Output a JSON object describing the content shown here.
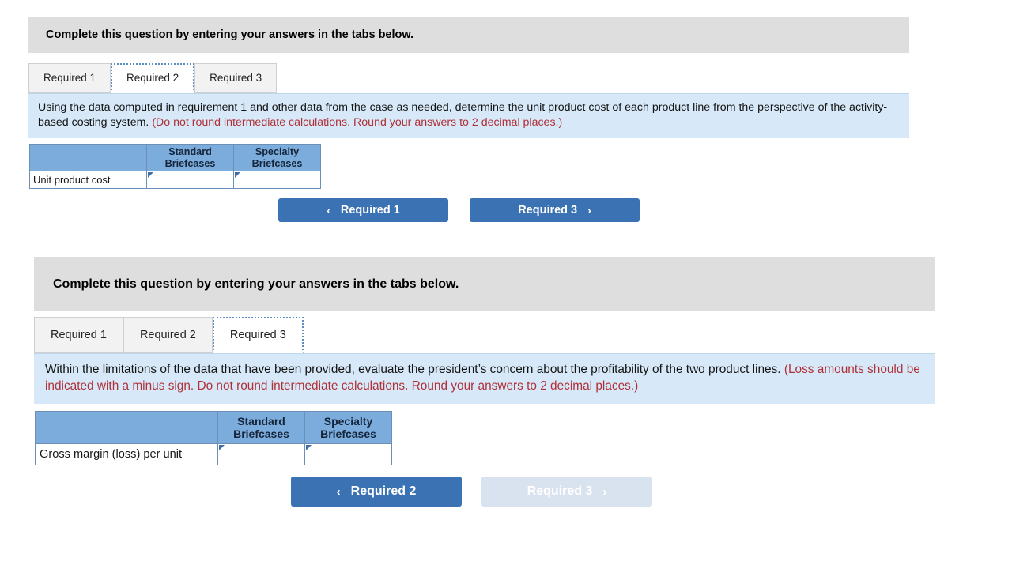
{
  "panels": [
    {
      "banner": "Complete this question by entering your answers in the tabs below.",
      "tabs": [
        {
          "label": "Required 1",
          "active": false
        },
        {
          "label": "Required 2",
          "active": true
        },
        {
          "label": "Required 3",
          "active": false
        }
      ],
      "instruction": {
        "black_lead": "Using the data computed in requirement 1 and other data from the case as needed, determine the unit product cost of each product line from the perspective of the activity-based costing system. ",
        "red_note": "(Do not round intermediate calculations. Round your answers to 2 decimal places.)"
      },
      "table": {
        "corner_header": "",
        "column_headers": [
          "Standard Briefcases",
          "Specialty Briefcases"
        ],
        "rows": [
          {
            "label": "Unit product cost",
            "values": [
              "",
              ""
            ]
          }
        ]
      },
      "nav": {
        "prev": {
          "label": "Required 1",
          "icon": "chevron-left-icon",
          "disabled": false
        },
        "next": {
          "label": "Required 3",
          "icon": "chevron-right-icon",
          "disabled": false
        }
      }
    },
    {
      "banner": "Complete this question by entering your answers in the tabs below.",
      "tabs": [
        {
          "label": "Required 1",
          "active": false
        },
        {
          "label": "Required 2",
          "active": false
        },
        {
          "label": "Required 3",
          "active": true
        }
      ],
      "instruction": {
        "black_lead": "Within the limitations of the data that have been provided, evaluate the president’s concern about the profitability of the two product lines. ",
        "red_note": "(Loss amounts should be indicated with a minus sign. Do not round intermediate calculations. Round your answers to 2 decimal places.)"
      },
      "table": {
        "corner_header": "",
        "column_headers": [
          "Standard Briefcases",
          "Specialty Briefcases"
        ],
        "rows": [
          {
            "label": "Gross margin (loss) per unit",
            "values": [
              "",
              ""
            ]
          }
        ]
      },
      "nav": {
        "prev": {
          "label": "Required 2",
          "icon": "chevron-left-icon",
          "disabled": false
        },
        "next": {
          "label": "Required 3",
          "icon": "chevron-right-icon",
          "disabled": true
        }
      }
    }
  ],
  "glyphs": {
    "chevron_left": "‹",
    "chevron_right": "›"
  },
  "colors": {
    "banner_bg": "#dedede",
    "instruction_bg": "#d7e9f8",
    "instruction_red": "#b03038",
    "table_header_bg": "#7bacdb",
    "table_border": "#6b8fb5",
    "button_bg": "#3b72b4",
    "button_disabled_bg": "#d9e2ef",
    "tab_bg": "#f2f2f2",
    "tab_active_border": "#5b8ec4",
    "input_marker": "#3f6ea8"
  }
}
